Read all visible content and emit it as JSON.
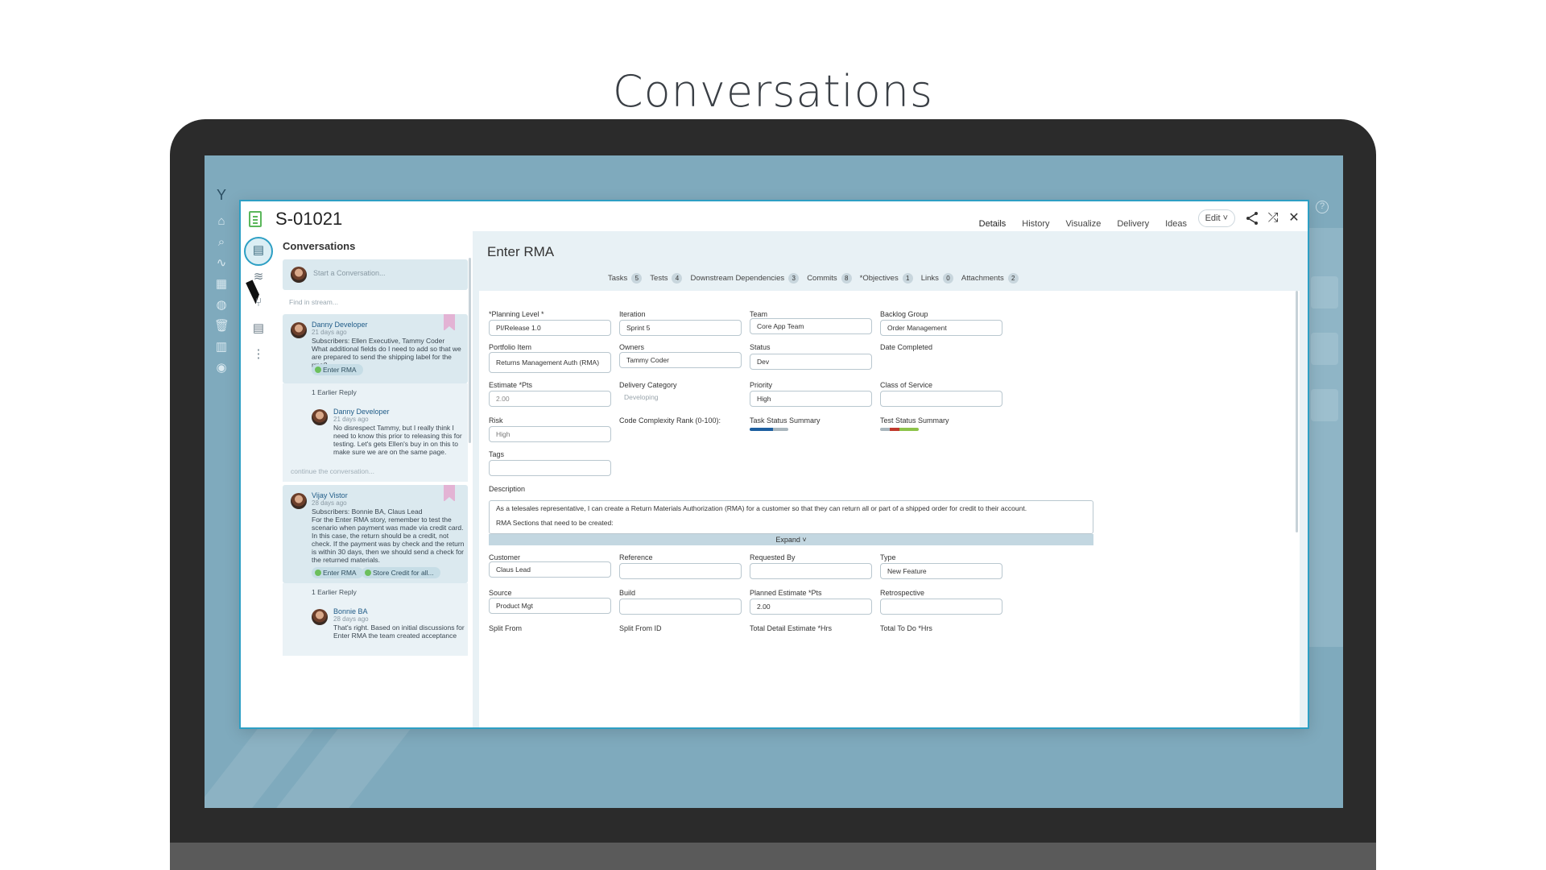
{
  "page": {
    "heading": "Conversations"
  },
  "story": {
    "id": "S-01021",
    "title": "Enter RMA"
  },
  "header": {
    "tabs": [
      "Details",
      "History",
      "Visualize",
      "Delivery",
      "Ideas"
    ],
    "active_tab": "Details",
    "edit_label": "Edit ˅",
    "icons": [
      "share-icon",
      "shuffle-icon",
      "close-icon"
    ]
  },
  "conversations": {
    "title": "Conversations",
    "start_placeholder": "Start a Conversation...",
    "find_placeholder": "Find in stream...",
    "threads": [
      {
        "author": "Danny Developer",
        "time": "21 days ago",
        "text": [
          "Subscribers: Ellen Executive, Tammy Coder",
          "What additional fields do I need to add so that we",
          "are prepared to send the shipping label for the rma?"
        ],
        "tags": [
          "Enter RMA"
        ],
        "earlier": "1 Earlier Reply",
        "reply": {
          "author": "Danny Developer",
          "time": "21 days ago",
          "text": [
            "No disrespect Tammy, but I really think I",
            "need to know this prior to releasing this for",
            "testing. Let's gets Ellen's buy in on this to",
            "make sure we are on the same page."
          ]
        },
        "continue": "continue the conversation..."
      },
      {
        "author": "Vijay Vistor",
        "time": "28 days ago",
        "text": [
          "Subscribers: Bonnie BA, Claus Lead",
          "For the Enter RMA story, remember to test the",
          "scenario when payment was made via credit card.",
          "In this case, the return should be a credit, not",
          "check. If the payment was by check and the return",
          "is within 30 days, then we should send a check for",
          "the returned materials."
        ],
        "tags": [
          "Enter RMA",
          "Store Credit for all..."
        ],
        "earlier": "1 Earlier Reply",
        "reply": {
          "author": "Bonnie BA",
          "time": "28 days ago",
          "text": [
            "That's right. Based on initial discussions for",
            "Enter RMA the team created acceptance"
          ]
        }
      }
    ]
  },
  "sub_tabs": [
    {
      "label": "Tasks",
      "count": "5"
    },
    {
      "label": "Tests",
      "count": "4"
    },
    {
      "label": "Downstream Dependencies",
      "count": "3"
    },
    {
      "label": "Commits",
      "count": "8"
    },
    {
      "label": "*Objectives",
      "count": "1"
    },
    {
      "label": "Links",
      "count": "0"
    },
    {
      "label": "Attachments",
      "count": "2"
    }
  ],
  "fields": {
    "planning_level": {
      "label": "*Planning Level *",
      "value": "PI/Release 1.0"
    },
    "iteration": {
      "label": "Iteration",
      "value": "Sprint 5"
    },
    "team": {
      "label": "Team",
      "value": "Core App Team"
    },
    "backlog_group": {
      "label": "Backlog Group",
      "value": "Order Management"
    },
    "portfolio_item": {
      "label": "Portfolio Item",
      "value": "Returns Management Auth (RMA)"
    },
    "owners": {
      "label": "Owners",
      "value": "Tammy Coder"
    },
    "status": {
      "label": "Status",
      "value": "Dev"
    },
    "date_completed": {
      "label": "Date Completed",
      "value": ""
    },
    "estimate": {
      "label": "Estimate *Pts",
      "value": "2.00"
    },
    "delivery_category": {
      "label": "Delivery Category",
      "value": "Developing"
    },
    "priority": {
      "label": "Priority",
      "value": "High"
    },
    "class_of_service": {
      "label": "Class of Service",
      "value": ""
    },
    "risk": {
      "label": "Risk",
      "value": "High"
    },
    "code_complexity": {
      "label": "Code Complexity Rank (0-100):",
      "value": ""
    },
    "task_status": {
      "label": "Task Status Summary"
    },
    "test_status": {
      "label": "Test Status Summary"
    },
    "tags": {
      "label": "Tags",
      "value": ""
    },
    "description": {
      "label": "Description",
      "line1": "As a telesales representative, I can create a Return Materials Authorization (RMA) for a customer so that they can return all or part of a shipped order for credit to their account.",
      "line2": "RMA Sections that need to be created:",
      "expand": "Expand ˅"
    },
    "customer": {
      "label": "Customer",
      "value": "Claus Lead"
    },
    "reference": {
      "label": "Reference",
      "value": ""
    },
    "requested_by": {
      "label": "Requested By",
      "value": ""
    },
    "type": {
      "label": "Type",
      "value": "New Feature"
    },
    "source": {
      "label": "Source",
      "value": "Product Mgt"
    },
    "build": {
      "label": "Build",
      "value": ""
    },
    "planned_estimate": {
      "label": "Planned Estimate *Pts",
      "value": "2.00"
    },
    "retrospective": {
      "label": "Retrospective",
      "value": ""
    },
    "split_from": {
      "label": "Split From"
    },
    "split_from_id": {
      "label": "Split From ID"
    },
    "total_detail_estimate": {
      "label": "Total Detail Estimate *Hrs"
    },
    "total_to_do": {
      "label": "Total To Do *Hrs"
    }
  },
  "colors": {
    "accent": "#2d9fc4",
    "screen_bg": "#7faabd",
    "progress_gray": "#a9b6bd",
    "progress_blue": "#1d5fa0",
    "test_red": "#c0392b",
    "test_green": "#8dc34a"
  },
  "status_summaries": {
    "task": {
      "done_fraction": 0.6
    },
    "test": {
      "failed_fraction": 0.25,
      "passed_fraction": 0.5
    }
  }
}
